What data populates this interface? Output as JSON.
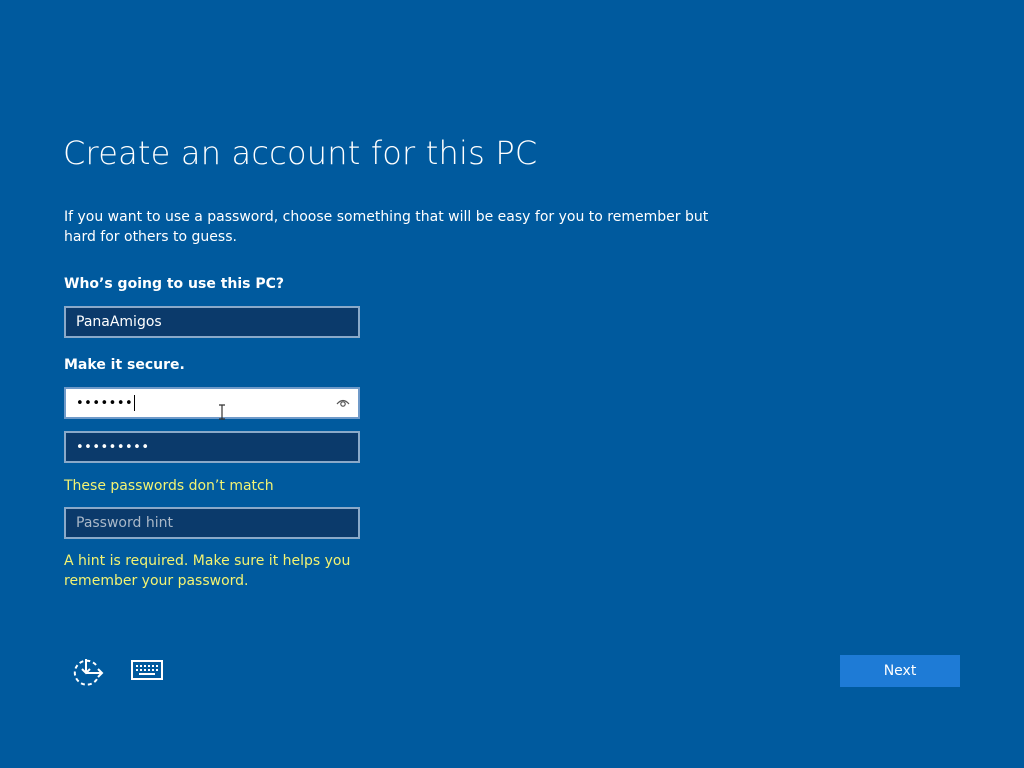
{
  "page": {
    "title": "Create an account for this PC",
    "description": "If you want to use a password, choose something that will be easy for you to remember but hard for others to guess."
  },
  "user_section": {
    "label": "Who’s going to use this PC?",
    "username_value": "PanaAmigos"
  },
  "secure_section": {
    "label": "Make it secure.",
    "password_value": "•••••••",
    "confirm_password_value": "•••••••••",
    "mismatch_error": "These passwords don’t match",
    "hint_placeholder": "Password hint",
    "hint_error": "A hint is required. Make sure it helps you remember your password."
  },
  "footer": {
    "ease_of_access_icon": "ease-of-access-icon",
    "keyboard_icon": "keyboard-icon",
    "next_label": "Next"
  },
  "colors": {
    "background": "#005a9e",
    "field_background": "#0b3a6b",
    "error_text": "#f3f372",
    "button": "#1e7bd6"
  }
}
